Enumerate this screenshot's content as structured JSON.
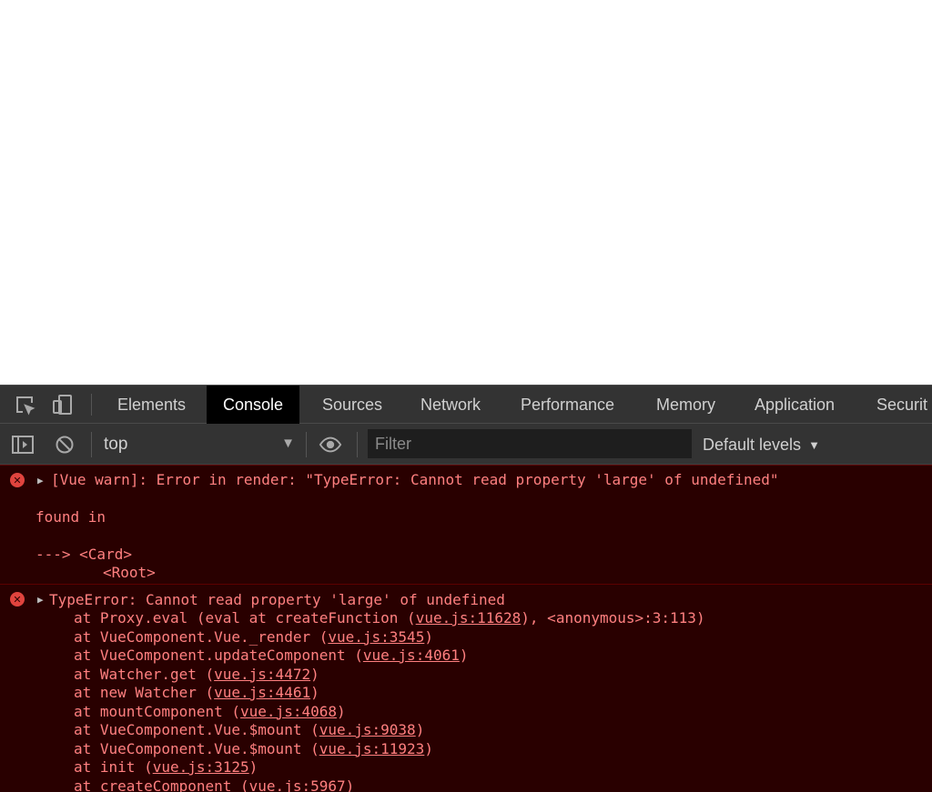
{
  "tabs": {
    "elements": "Elements",
    "console": "Console",
    "sources": "Sources",
    "network": "Network",
    "performance": "Performance",
    "memory": "Memory",
    "application": "Application",
    "security": "Securit"
  },
  "toolbar": {
    "context": "top",
    "context_arrow": "▼",
    "filter_placeholder": "Filter",
    "levels": "Default levels",
    "levels_arrow": "▼"
  },
  "messages": {
    "vue_warn": {
      "text": "[Vue warn]: Error in render: \"TypeError: Cannot read property 'large' of undefined\"",
      "found_in": "found in",
      "card": "---> <Card>",
      "root": "<Root>"
    },
    "type_error": {
      "text": "TypeError: Cannot read property 'large' of undefined",
      "stack": [
        {
          "prefix": "at Proxy.eval (eval at createFunction (",
          "link": "vue.js:11628",
          "suffix": "), <anonymous>:3:113)"
        },
        {
          "prefix": "at VueComponent.Vue._render (",
          "link": "vue.js:3545",
          "suffix": ")"
        },
        {
          "prefix": "at VueComponent.updateComponent (",
          "link": "vue.js:4061",
          "suffix": ")"
        },
        {
          "prefix": "at Watcher.get (",
          "link": "vue.js:4472",
          "suffix": ")"
        },
        {
          "prefix": "at new Watcher (",
          "link": "vue.js:4461",
          "suffix": ")"
        },
        {
          "prefix": "at mountComponent (",
          "link": "vue.js:4068",
          "suffix": ")"
        },
        {
          "prefix": "at VueComponent.Vue.$mount (",
          "link": "vue.js:9038",
          "suffix": ")"
        },
        {
          "prefix": "at VueComponent.Vue.$mount (",
          "link": "vue.js:11923",
          "suffix": ")"
        },
        {
          "prefix": "at init (",
          "link": "vue.js:3125",
          "suffix": ")"
        },
        {
          "prefix": "at createComponent (",
          "link": "vue.js:5967",
          "suffix": ")"
        }
      ]
    }
  },
  "colors": {
    "error_bg": "#290000",
    "error_text": "#ff8080",
    "error_icon": "#e0443e",
    "panel_bg": "#333333"
  },
  "icons": {
    "inspect": "inspect-element-icon",
    "device": "device-toolbar-icon",
    "sidebar": "show-sidebar-icon",
    "clear": "clear-console-icon",
    "eye": "live-expression-icon",
    "error": "error-icon",
    "expand": "expand-triangle-icon"
  }
}
